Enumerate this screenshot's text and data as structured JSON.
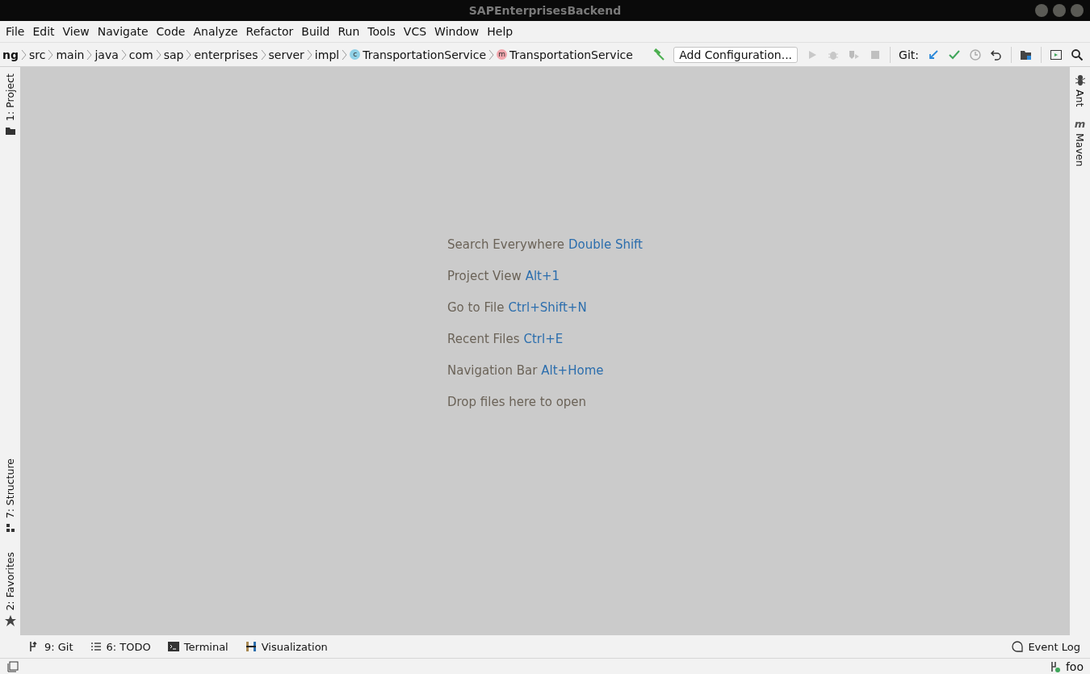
{
  "window": {
    "title": "SAPEnterprisesBackend"
  },
  "menu": [
    "File",
    "Edit",
    "View",
    "Navigate",
    "Code",
    "Analyze",
    "Refactor",
    "Build",
    "Run",
    "Tools",
    "VCS",
    "Window",
    "Help"
  ],
  "breadcrumbs": [
    {
      "label": "ng",
      "kind": "folder",
      "bold": true
    },
    {
      "label": "src",
      "kind": "folder",
      "bold": false
    },
    {
      "label": "main",
      "kind": "folder",
      "bold": false
    },
    {
      "label": "java",
      "kind": "folder",
      "bold": false
    },
    {
      "label": "com",
      "kind": "folder",
      "bold": false
    },
    {
      "label": "sap",
      "kind": "folder",
      "bold": false
    },
    {
      "label": "enterprises",
      "kind": "folder",
      "bold": false
    },
    {
      "label": "server",
      "kind": "folder",
      "bold": false
    },
    {
      "label": "impl",
      "kind": "folder",
      "bold": false
    },
    {
      "label": "TransportationService",
      "kind": "class",
      "badge": "c",
      "bold": false
    },
    {
      "label": "TransportationService",
      "kind": "method",
      "badge": "m",
      "bold": false
    }
  ],
  "run_config": {
    "label": "Add Configuration..."
  },
  "git": {
    "label": "Git:"
  },
  "left_tools_top": [
    {
      "label": "1: Project",
      "kind": "folder"
    }
  ],
  "left_tools_bottom": [
    {
      "label": "7: Structure",
      "kind": "structure"
    },
    {
      "label": "2: Favorites",
      "kind": "star"
    }
  ],
  "right_tools": [
    {
      "label": "Ant",
      "kind": "ant"
    },
    {
      "label": "Maven",
      "kind": "maven",
      "badge": "m"
    }
  ],
  "hints": [
    {
      "label": "Search Everywhere",
      "shortcut": "Double Shift"
    },
    {
      "label": "Project View",
      "shortcut": "Alt+1"
    },
    {
      "label": "Go to File",
      "shortcut": "Ctrl+Shift+N"
    },
    {
      "label": "Recent Files",
      "shortcut": "Ctrl+E"
    },
    {
      "label": "Navigation Bar",
      "shortcut": "Alt+Home"
    },
    {
      "label": "Drop files here to open"
    }
  ],
  "bottom_tools": [
    {
      "label": "9: Git",
      "kind": "git"
    },
    {
      "label": "6: TODO",
      "kind": "todo"
    },
    {
      "label": "Terminal",
      "kind": "terminal"
    },
    {
      "label": "Visualization",
      "kind": "visualization"
    }
  ],
  "event_log": {
    "label": "Event Log"
  },
  "status_bar": {
    "branch": "foo"
  }
}
